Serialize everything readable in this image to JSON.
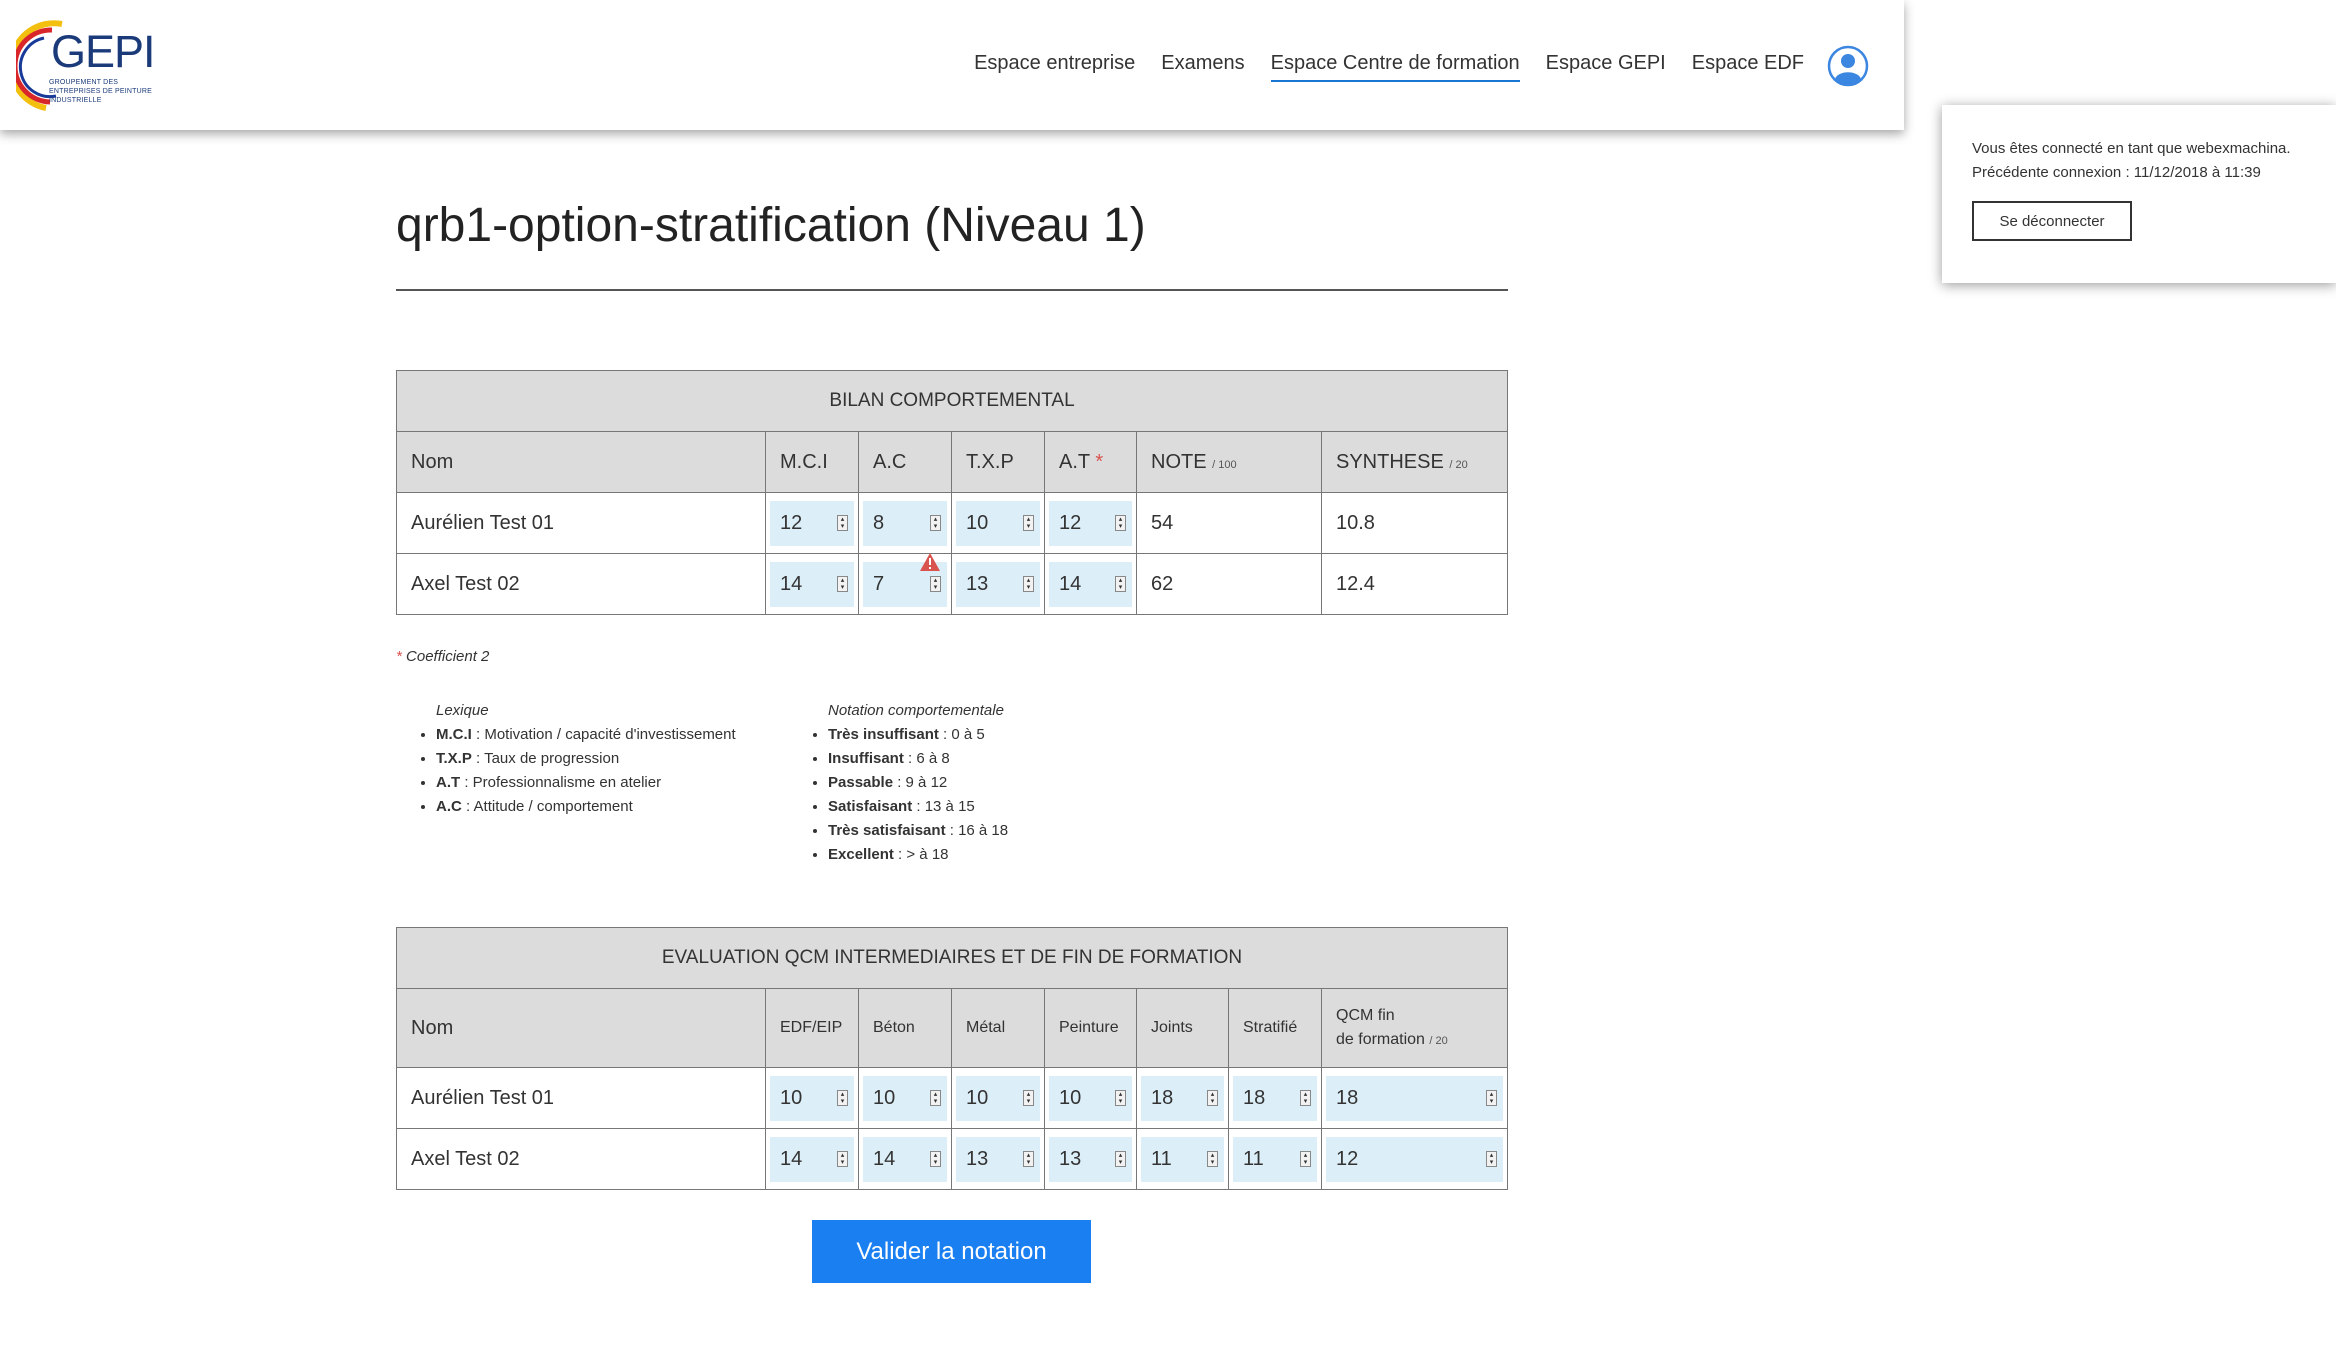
{
  "header": {
    "logo_text": "GEPI",
    "logo_sub": "GROUPEMENT DES ENTREPRISES DE PEINTURE INDUSTRIELLE",
    "nav": [
      {
        "label": "Espace entreprise",
        "active": false
      },
      {
        "label": "Examens",
        "active": false
      },
      {
        "label": "Espace Centre de formation",
        "active": true
      },
      {
        "label": "Espace GEPI",
        "active": false
      },
      {
        "label": "Espace EDF",
        "active": false
      }
    ]
  },
  "session": {
    "connected": "Vous êtes connecté en tant que webexmachina.",
    "previous": "Précédente connexion : 11/12/2018 à 11:39",
    "logout": "Se déconnecter"
  },
  "page": {
    "title": "qrb1-option-stratification (Niveau 1)"
  },
  "bilan": {
    "title": "BILAN COMPORTEMENTAL",
    "cols": {
      "nom": "Nom",
      "mci": "M.C.I",
      "ac": "A.C",
      "txp": "T.X.P",
      "at": "A.T",
      "at_req": "*",
      "note": "NOTE",
      "note_unit": "/ 100",
      "synth": "SYNTHESE",
      "synth_unit": "/ 20"
    },
    "rows": [
      {
        "nom": "Aurélien Test 01",
        "mci": "12",
        "ac": "8",
        "txp": "10",
        "at": "12",
        "note": "54",
        "synth": "10.8"
      },
      {
        "nom": "Axel Test 02",
        "mci": "14",
        "ac": "7",
        "txp": "13",
        "at": "14",
        "note": "62",
        "synth": "12.4"
      }
    ]
  },
  "notes": {
    "coef_star": "*",
    "coef": "Coefficient 2",
    "lexique_title": "Lexique",
    "lexique": [
      {
        "k": "M.C.I",
        "v": " : Motivation / capacité d'investissement"
      },
      {
        "k": "T.X.P",
        "v": " : Taux de progression"
      },
      {
        "k": "A.T",
        "v": " : Professionnalisme en atelier"
      },
      {
        "k": "A.C",
        "v": " : Attitude / comportement"
      }
    ],
    "notation_title": "Notation comportementale",
    "notation": [
      {
        "k": "Très insuffisant",
        "v": " : 0 à 5"
      },
      {
        "k": "Insuffisant",
        "v": " : 6 à 8"
      },
      {
        "k": "Passable",
        "v": " : 9 à 12"
      },
      {
        "k": "Satisfaisant",
        "v": " : 13 à 15"
      },
      {
        "k": "Très satisfaisant",
        "v": " : 16 à 18"
      },
      {
        "k": "Excellent",
        "v": " : > à 18"
      }
    ]
  },
  "qcm": {
    "title": "EVALUATION QCM INTERMEDIAIRES ET DE FIN DE FORMATION",
    "cols": {
      "nom": "Nom",
      "edf": "EDF/EIP",
      "beton": "Béton",
      "metal": "Métal",
      "peinture": "Peinture",
      "joints": "Joints",
      "strat": "Stratifié",
      "fin1": "QCM fin",
      "fin2": "de formation",
      "fin_unit": "/ 20"
    },
    "rows": [
      {
        "nom": "Aurélien Test 01",
        "edf": "10",
        "beton": "10",
        "metal": "10",
        "peinture": "10",
        "joints": "18",
        "strat": "18",
        "fin": "18"
      },
      {
        "nom": "Axel Test 02",
        "edf": "14",
        "beton": "14",
        "metal": "13",
        "peinture": "13",
        "joints": "11",
        "strat": "11",
        "fin": "12"
      }
    ]
  },
  "actions": {
    "validate": "Valider la notation"
  }
}
